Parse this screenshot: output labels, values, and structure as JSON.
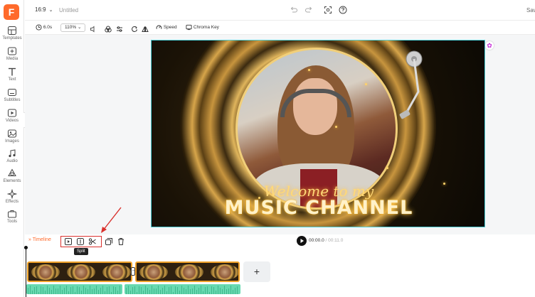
{
  "sidebar": {
    "logo": "F",
    "items": [
      {
        "label": "Templates",
        "icon": "templates-icon"
      },
      {
        "label": "Media",
        "icon": "media-icon"
      },
      {
        "label": "Text",
        "icon": "text-icon"
      },
      {
        "label": "Subtitles",
        "icon": "subtitles-icon"
      },
      {
        "label": "Videos",
        "icon": "videos-icon"
      },
      {
        "label": "Images",
        "icon": "images-icon"
      },
      {
        "label": "Audio",
        "icon": "audio-icon"
      },
      {
        "label": "Elements",
        "icon": "elements-icon"
      },
      {
        "label": "Effects",
        "icon": "effects-icon"
      },
      {
        "label": "Tools",
        "icon": "tools-icon"
      }
    ]
  },
  "topbar": {
    "aspect_ratio": "16:9",
    "title": "Untitled",
    "save_label": "Sav"
  },
  "toolbar": {
    "duration": "6.0s",
    "zoom": "110%",
    "speed_label": "Speed",
    "chroma_key_label": "Chroma Key"
  },
  "canvas": {
    "headline_script": "Welcome to my",
    "headline_main": "MUSIC CHANNEL",
    "accent_color": "#4fd1d9"
  },
  "timeline": {
    "label": "Timeline",
    "tooltip": "Split",
    "current_time": "00:00.0",
    "total_time": "/ 00:11.0",
    "add_label": "+",
    "clip_color": "#f0a22a",
    "audio_color": "#67d9b0"
  }
}
